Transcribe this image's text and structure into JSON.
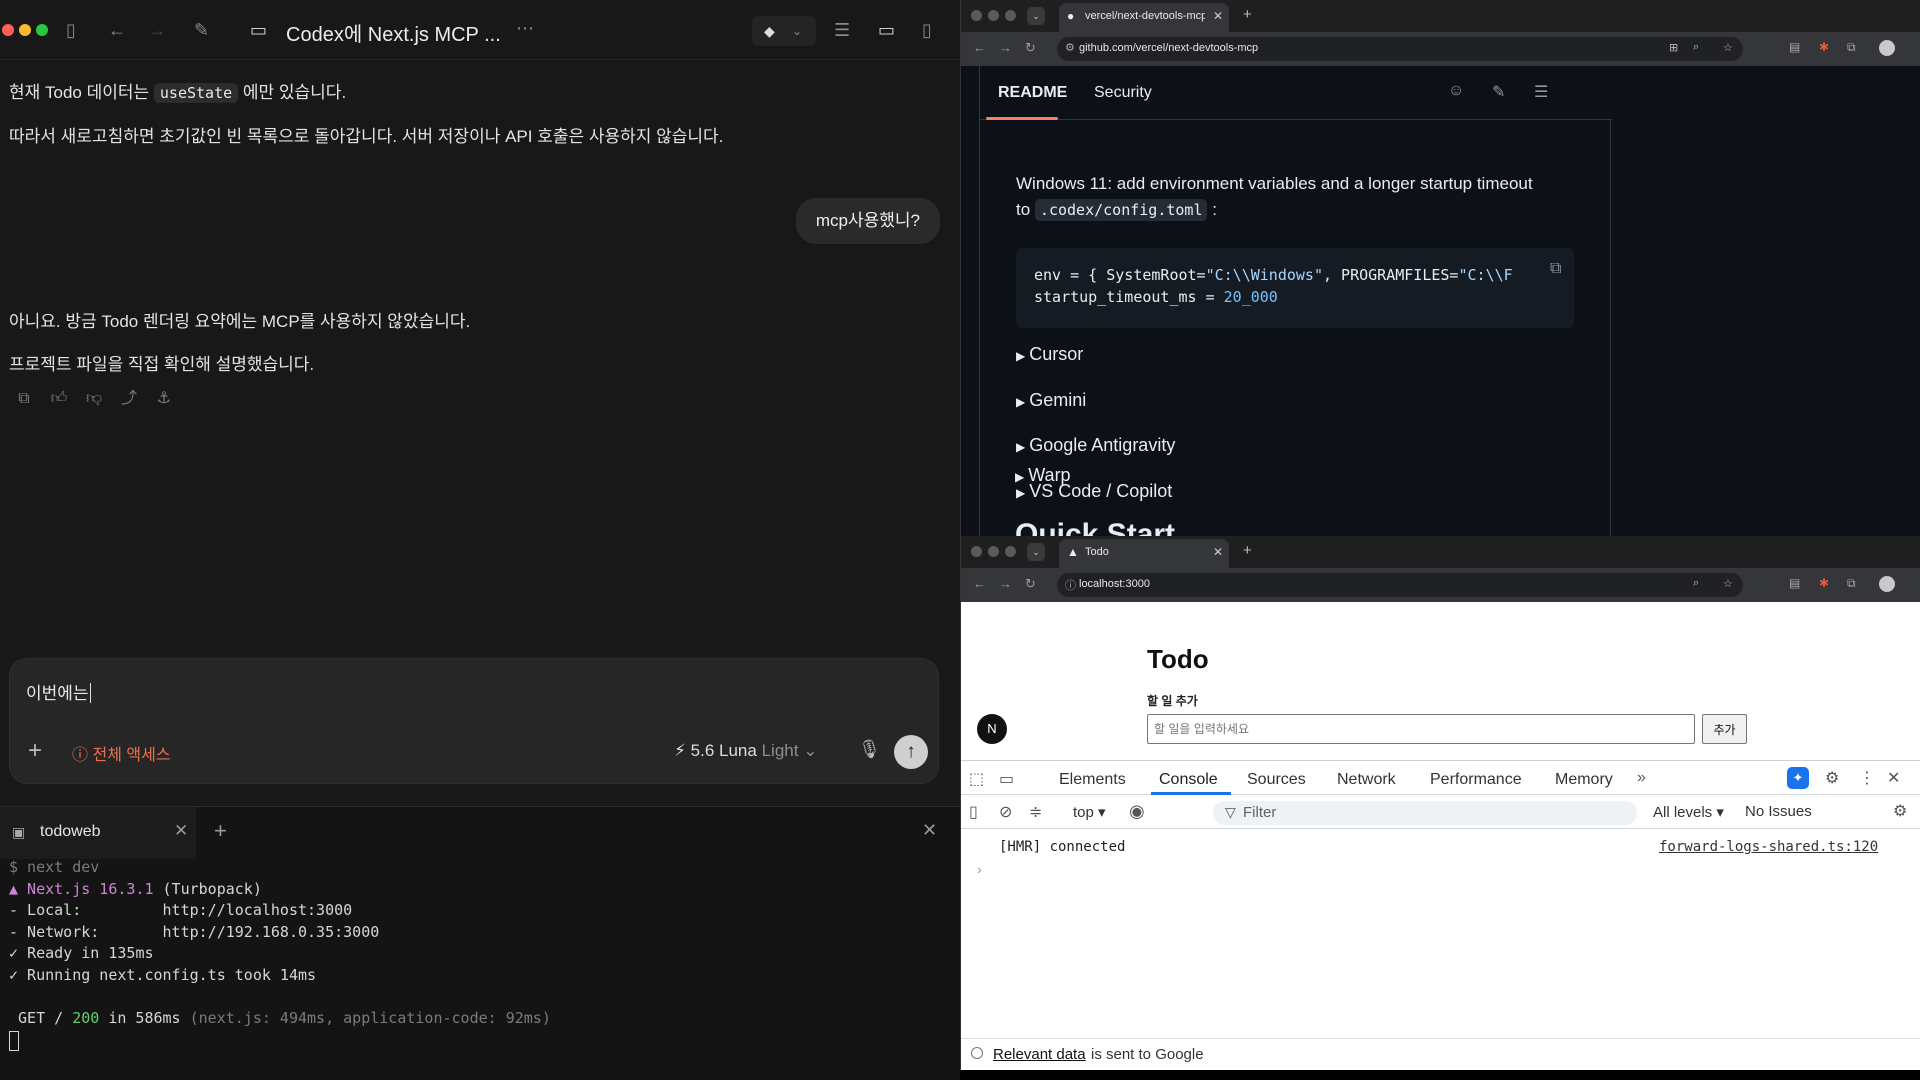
{
  "codex": {
    "title": "Codex에 Next.js MCP ...",
    "messages": {
      "assistant_1_line1_pre": "현재 Todo 데이터는",
      "assistant_1_code": "useState",
      "assistant_1_line1_post": "에만 있습니다.",
      "assistant_1_line2": "따라서 새로고침하면 초기값인 빈 목록으로 돌아갑니다. 서버 저장이나 API 호출은 사용하지 않습니다.",
      "user": "mcp사용했니?",
      "assistant_2_line1": "아니요. 방금 Todo 렌더링 요약에는 MCP를 사용하지 않았습니다.",
      "assistant_2_line2": "프로젝트 파일을 직접 확인해 설명했습니다."
    },
    "composer": {
      "text": "이번에는",
      "access_label": "전체 액세스",
      "model_version": "5.6 Luna",
      "model_variant": "Light"
    },
    "terminal": {
      "tab_label": "todoweb",
      "lines": {
        "cmd": "$ next dev",
        "nextjs_prefix": "▲ Next.js 16.3.1",
        "nextjs_suffix": " (Turbopack)",
        "local": "- Local:         http://localhost:3000",
        "network": "- Network:       http://192.168.0.35:3000",
        "ready": "✓ Ready in 135ms",
        "running": "✓ Running next.config.ts took 14ms",
        "get_pre": " GET / ",
        "get_status": "200",
        "get_mid": " in 586ms ",
        "get_detail": "(next.js: 494ms, application-code: 92ms)"
      }
    }
  },
  "github_window": {
    "tab_title": "vercel/next-devtools-mcp: Ne",
    "url": "github.com/vercel/next-devtools-mcp",
    "readme_tabs": [
      "README",
      "Security"
    ],
    "text_line1": "Windows 11: add environment variables and a longer startup timeout",
    "text_line2_pre": "to",
    "text_line2_code": ".codex/config.toml",
    "text_line2_post": ":",
    "code": {
      "l1_a": "env = { SystemRoot=",
      "l1_s1": "\"C:\\\\Windows\"",
      "l1_b": ", PROGRAMFILES=",
      "l1_s2": "\"C:\\\\F",
      "l2_a": "startup_timeout_ms = ",
      "l2_n": "20_000"
    },
    "sections": [
      "Cursor",
      "Gemini",
      "Google Antigravity",
      "VS Code / Copilot",
      "Warp"
    ],
    "next_heading": "Quick Start"
  },
  "todo_window": {
    "tab_title": "Todo",
    "url": "localhost:3000",
    "heading": "Todo",
    "label": "할 일 추가",
    "placeholder": "할 일을 입력하세요",
    "button": "추가",
    "badge": "N"
  },
  "devtools": {
    "tabs": [
      "Elements",
      "Console",
      "Sources",
      "Network",
      "Performance",
      "Memory"
    ],
    "context": "top",
    "filter_placeholder": "Filter",
    "levels": "All levels",
    "issues": "No Issues",
    "log_message": "[HMR] connected",
    "log_source": "forward-logs-shared.ts:120",
    "footer_link": "Relevant data",
    "footer_text": "is sent to Google"
  }
}
